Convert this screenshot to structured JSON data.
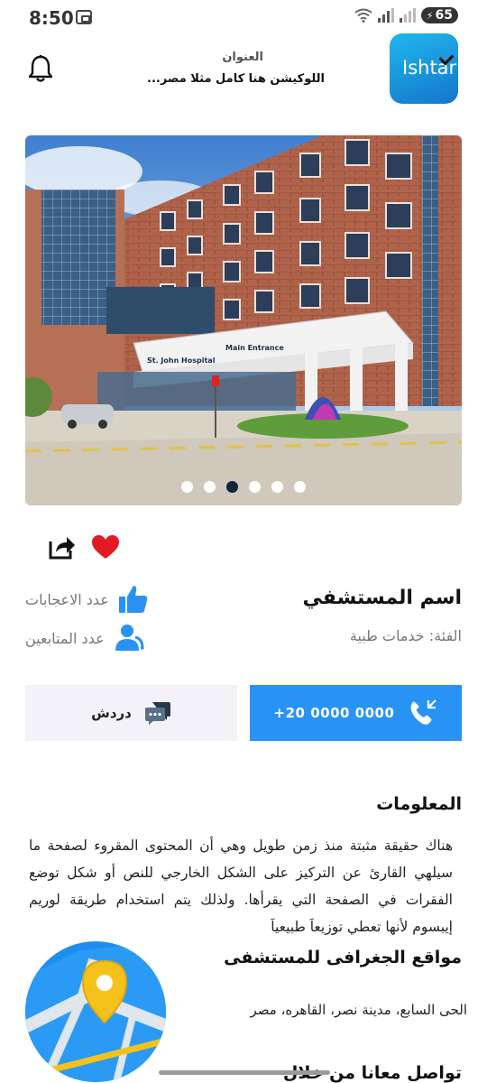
{
  "status_bar": {
    "time": "8:50",
    "battery": "65"
  },
  "header": {
    "logo_text": "Ishtar",
    "title": "العنوان",
    "subtitle": "اللوكيشن هنا كامل مثلا مصر..."
  },
  "gallery": {
    "image_signs": [
      "St. John Hospital",
      "Main Entrance"
    ],
    "dot_count": 6,
    "active_dot": 3
  },
  "hospital": {
    "name": "اسم المستشفي",
    "category": "الفئة: خدمات طبية",
    "likes_label": "عدد الاعجابات",
    "followers_label": "عدد المتابعين"
  },
  "actions": {
    "chat_label": "دردش",
    "phone_label": "+20 0000 0000"
  },
  "info": {
    "title": "المعلومات",
    "body": "هناك حقيقة مثبتة منذ زمن طويل وهي أن المحتوى المقروء لصفحة ما سيلهي القارئ عن التركيز على الشكل الخارجي للنص أو شكل توضع الفقرات في الصفحة التي يقرأها. ولذلك يتم استخدام طريقة لوريم إيبسوم لأنها تعطي توزيعاَ طبيعياَ"
  },
  "geo": {
    "title": "مواقع الجغرافى للمستشفى",
    "address": "الحى السابع، مدينة نصر، القاهره، مصر"
  },
  "contact": {
    "title": "تواصل معانا من خلال"
  },
  "colors": {
    "primary": "#2893f4",
    "heart": "#e21b23",
    "active_dot": "#12263a"
  }
}
